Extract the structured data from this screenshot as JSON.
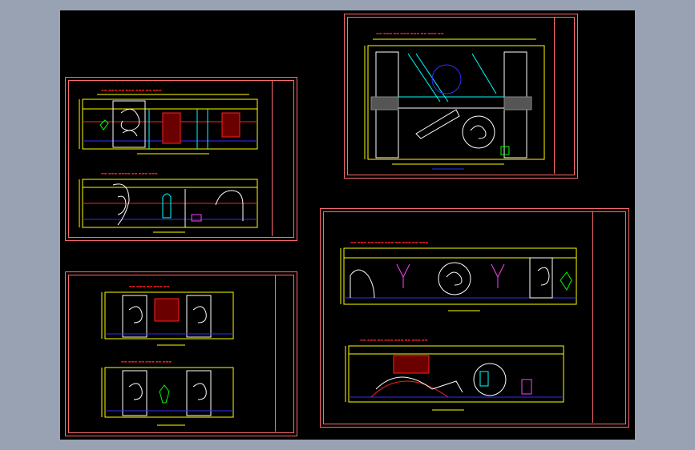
{
  "window": {
    "background": "#98a2b3",
    "model_space_color": "#000000"
  },
  "colors": {
    "frame": "#ff6a6a",
    "yellow": "#ffff00",
    "red": "#ff2020",
    "cyan": "#00ffff",
    "blue": "#3030ff",
    "white": "#ffffff",
    "green": "#00ff00",
    "magenta": "#ff40ff"
  },
  "sheets": [
    {
      "id": "sheet-top-left",
      "description_icon": "elevation-drawing-icon"
    },
    {
      "id": "sheet-top-right",
      "description_icon": "elevation-drawing-icon"
    },
    {
      "id": "sheet-bottom-left",
      "description_icon": "elevation-drawing-icon"
    },
    {
      "id": "sheet-bottom-right",
      "description_icon": "elevation-drawing-icon"
    }
  ]
}
